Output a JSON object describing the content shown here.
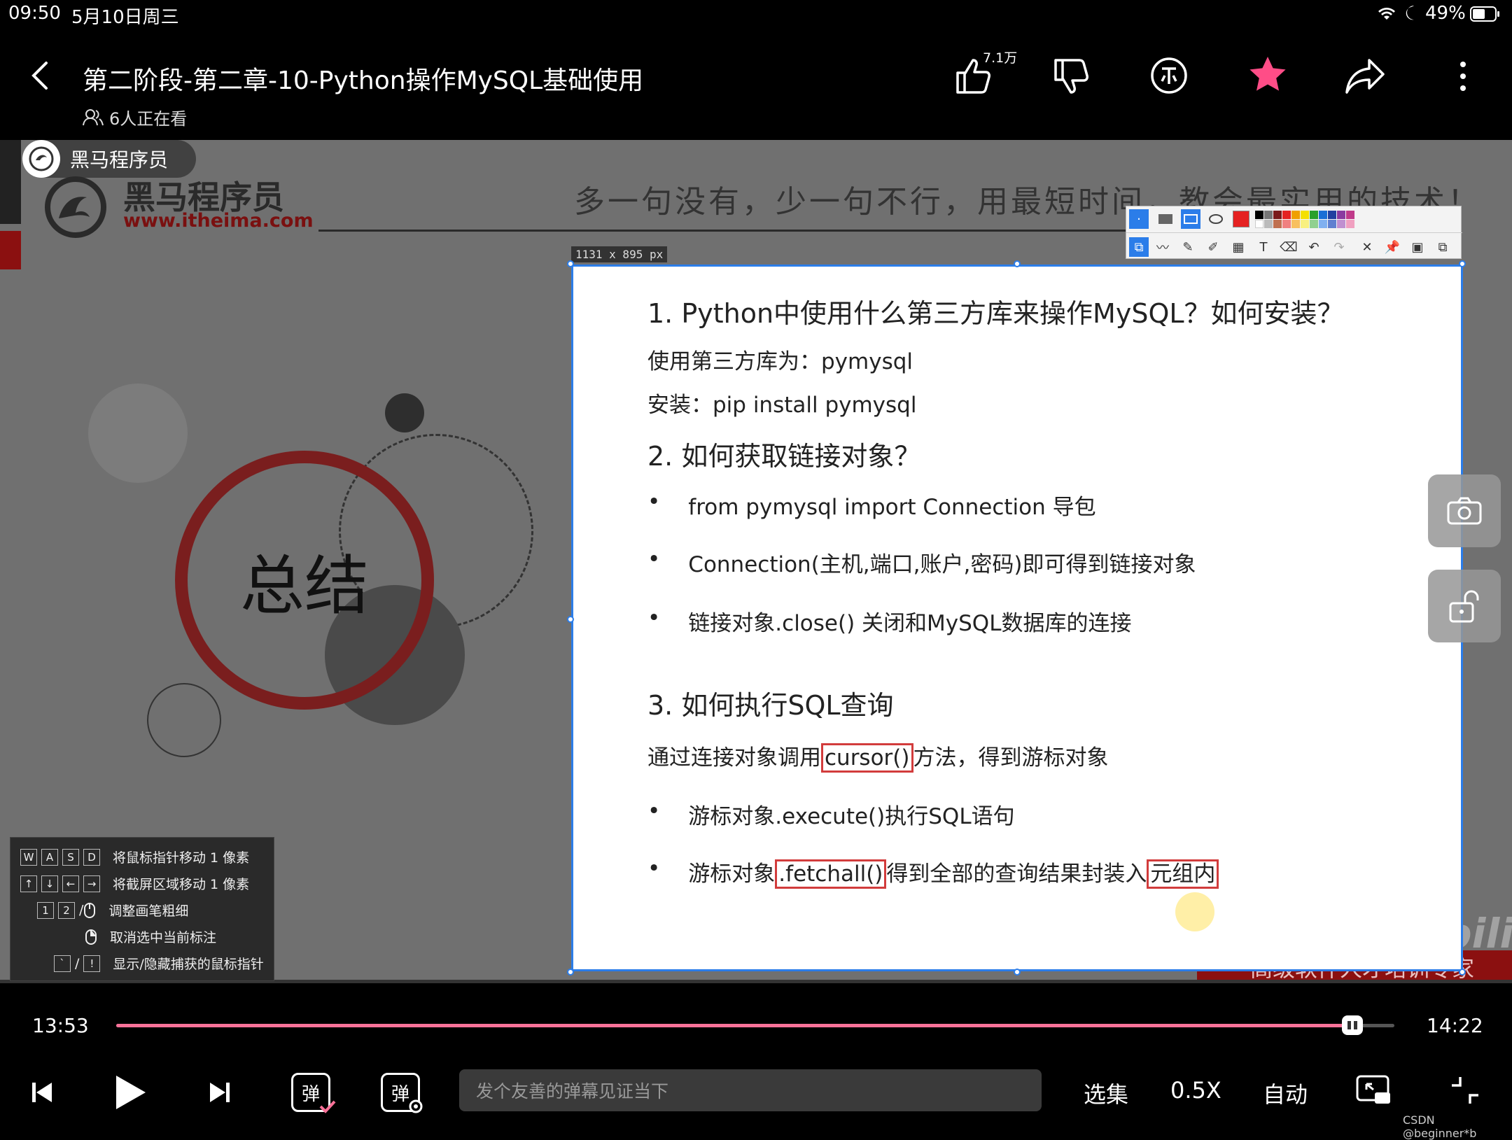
{
  "status_bar": {
    "time": "09:50",
    "date": "5月10日周三",
    "battery": "49%",
    "icons": [
      "wifi-icon",
      "moon-icon",
      "battery-icon"
    ]
  },
  "header": {
    "title": "第二阶段-第二章-10-Python操作MySQL基础使用",
    "viewers": "6人正在看",
    "like_count": "7.1万"
  },
  "video": {
    "channel_name": "黑马程序员",
    "watermark_logo_text": "黑马程序员",
    "watermark_url": "www.itheima.com",
    "slogan": "多一句没有，少一句不行，用最短时间，教会最实用的技术！",
    "summary_label": "总结",
    "bottom_banner": "高级软件人才培训专家",
    "bilibili_mark": "bilibili",
    "capture_size": "1131 x 895   px"
  },
  "doc": {
    "q1": "1. Python中使用什么第三方库来操作MySQL？如何安装？",
    "q1_lib": "使用第三方库为：pymysql",
    "q1_install": "安装：pip install pymysql",
    "q2": "2. 如何获取链接对象？",
    "q2_b1": "from pymysql import Connection 导包",
    "q2_b2": "Connection(主机,端口,账户,密码)即可得到链接对象",
    "q2_b3": "链接对象.close() 关闭和MySQL数据库的连接",
    "q3": "3. 如何执行SQL查询",
    "q3_p_pre": "通过连接对象调用",
    "q3_p_box": "cursor()",
    "q3_p_post": "方法，得到游标对象",
    "q3_b1": "游标对象.execute()执行SQL语句",
    "q3_b2_pre": "游标对象",
    "q3_b2_box": ".fetchall()",
    "q3_b2_mid": "得到全部的查询结果封装入",
    "q3_b2_box2": "元组内",
    "bullet": "•"
  },
  "help": {
    "rows": [
      {
        "keys": [
          "W",
          "A",
          "S",
          "D"
        ],
        "text": "将鼠标指针移动 1 像素"
      },
      {
        "keys": [
          "↑",
          "↓",
          "←",
          "→"
        ],
        "text": "将截屏区域移动 1 像素"
      },
      {
        "keys": [
          "1",
          "2"
        ],
        "text": "调整画笔粗细"
      },
      {
        "keys": [],
        "text": "取消选中当前标注"
      },
      {
        "keys": [
          "`",
          "!"
        ],
        "text": "显示/隐藏捕获的鼠标指针"
      }
    ]
  },
  "player": {
    "current_time": "13:53",
    "total_time": "14:22",
    "progress": 0.967,
    "danmaku_placeholder": "发个友善的弹幕见证当下",
    "danmaku_toggle_label": "弹",
    "danmaku_settings_label": "弹",
    "episodes_label": "选集",
    "speed_label": "0.5X",
    "quality_label": "自动"
  },
  "footer_credit": "CSDN @beginner*b",
  "colors": {
    "accent_pink": "#fb7299",
    "favorite_pink": "#ff4d87",
    "selection_blue": "#2b7de9",
    "annotation_red": "#d23c3c"
  }
}
